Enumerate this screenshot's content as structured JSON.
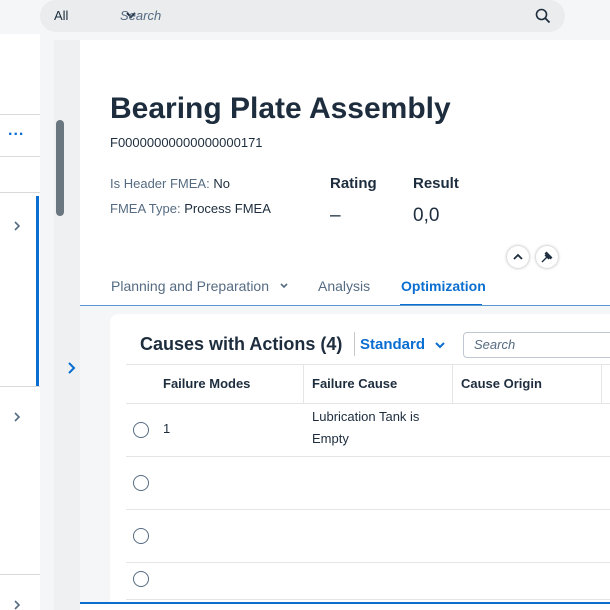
{
  "search": {
    "scope": "All",
    "placeholder": "Search"
  },
  "left_pane": {
    "overflow_label": "..."
  },
  "header": {
    "title": "Bearing Plate Assembly",
    "object_id": "F00000000000000000171",
    "attributes": [
      {
        "label": "Is Header FMEA:",
        "value": "No"
      },
      {
        "label": "FMEA Type:",
        "value": "Process FMEA"
      }
    ],
    "kpis": [
      {
        "label": "Rating",
        "value": "–"
      },
      {
        "label": "Result",
        "value": "0,0"
      }
    ]
  },
  "tabs": [
    {
      "label": "Planning and Preparation",
      "has_dropdown": true,
      "selected": false
    },
    {
      "label": "Analysis",
      "selected": false
    },
    {
      "label": "Optimization",
      "selected": true
    }
  ],
  "table_card": {
    "title": "Causes with Actions (4)",
    "variant": "Standard",
    "search_placeholder": "Search",
    "columns": [
      "Failure Modes",
      "Failure Cause",
      "Cause Origin"
    ],
    "rows": [
      {
        "failure_mode": "1",
        "failure_cause_line1": "Lubrication Tank is",
        "failure_cause_line2": "Empty",
        "cause_origin": ""
      },
      {
        "failure_mode": "",
        "failure_cause_line1": "",
        "failure_cause_line2": "",
        "cause_origin": ""
      },
      {
        "failure_mode": "",
        "failure_cause_line1": "",
        "failure_cause_line2": "",
        "cause_origin": ""
      },
      {
        "failure_mode": "",
        "failure_cause_line1": "",
        "failure_cause_line2": "",
        "cause_origin": ""
      }
    ]
  },
  "colors": {
    "accent": "#0a6ed1",
    "text": "#1d2d3e",
    "muted": "#556b82"
  }
}
